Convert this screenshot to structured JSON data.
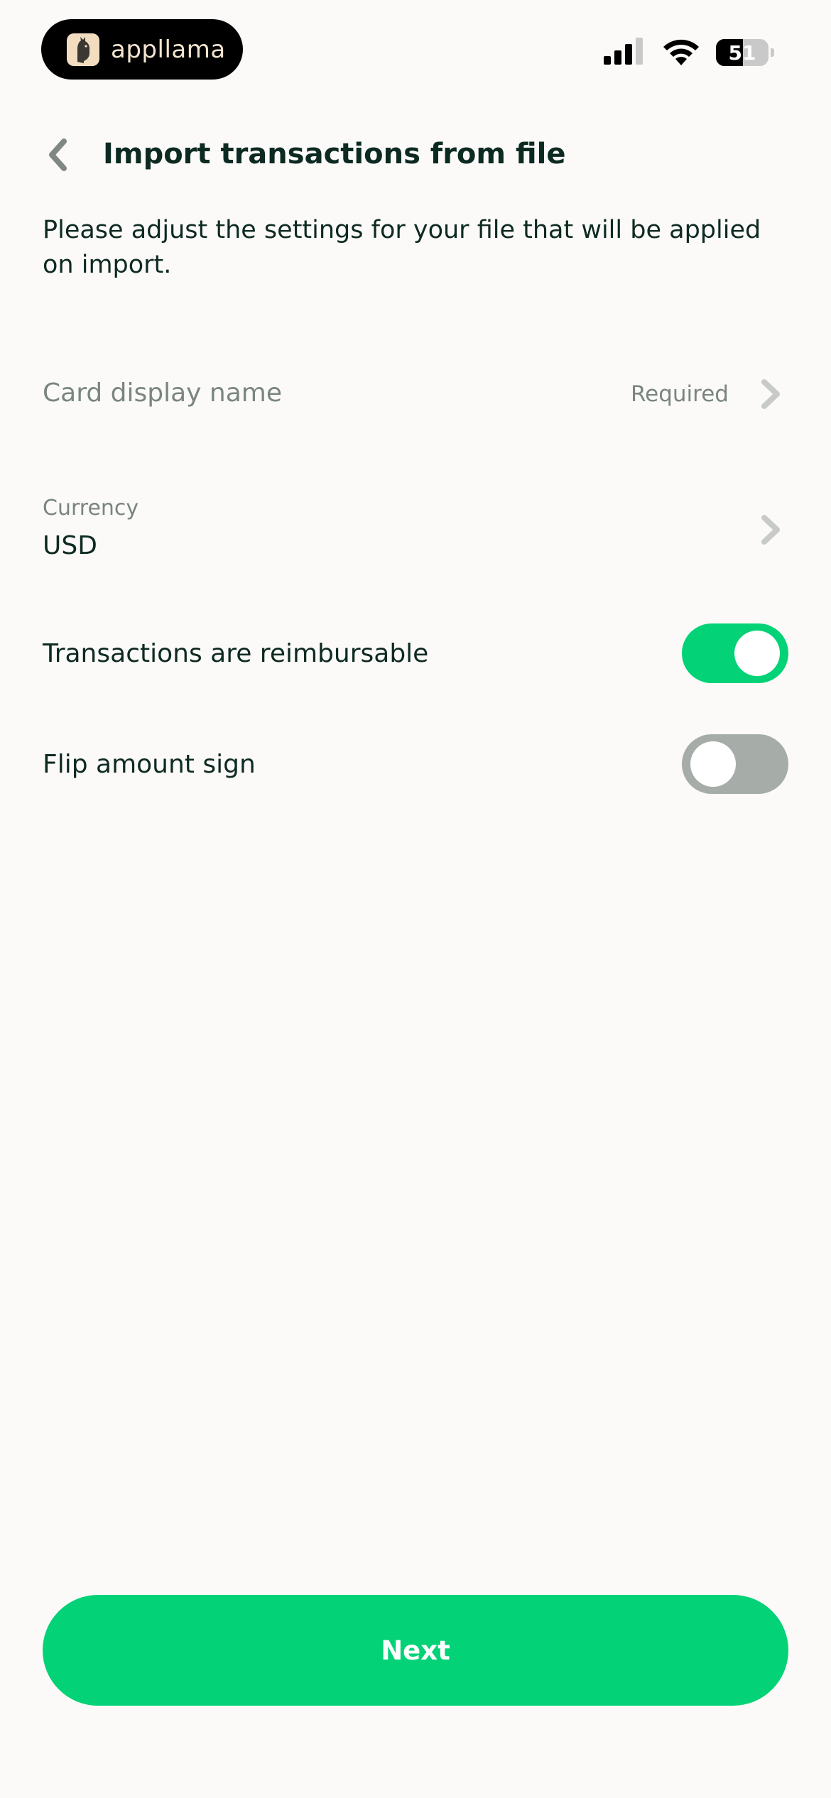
{
  "status_bar": {
    "app_badge_name": "appllama",
    "battery_level": "51",
    "battery_percent": 51,
    "signal_icon": "cellular-signal-icon",
    "wifi_icon": "wifi-icon",
    "battery_icon": "battery-icon"
  },
  "header": {
    "title": "Import transactions from file",
    "back_icon": "chevron-left-icon"
  },
  "description": "Please adjust the settings for your file that will be applied on import.",
  "settings": {
    "card_display_name": {
      "label": "Card display name",
      "hint": "Required",
      "icon": "chevron-right-icon"
    },
    "currency": {
      "label": "Currency",
      "value": "USD",
      "icon": "chevron-right-icon"
    },
    "reimbursable": {
      "label": "Transactions are reimbursable",
      "enabled": true
    },
    "flip_sign": {
      "label": "Flip amount sign",
      "enabled": false
    }
  },
  "footer": {
    "next_label": "Next"
  },
  "colors": {
    "accent": "#03d277",
    "background": "#fbfaf8",
    "text_primary": "#0e2a22",
    "text_secondary": "#7a8580",
    "toggle_off": "#a6aca7"
  }
}
